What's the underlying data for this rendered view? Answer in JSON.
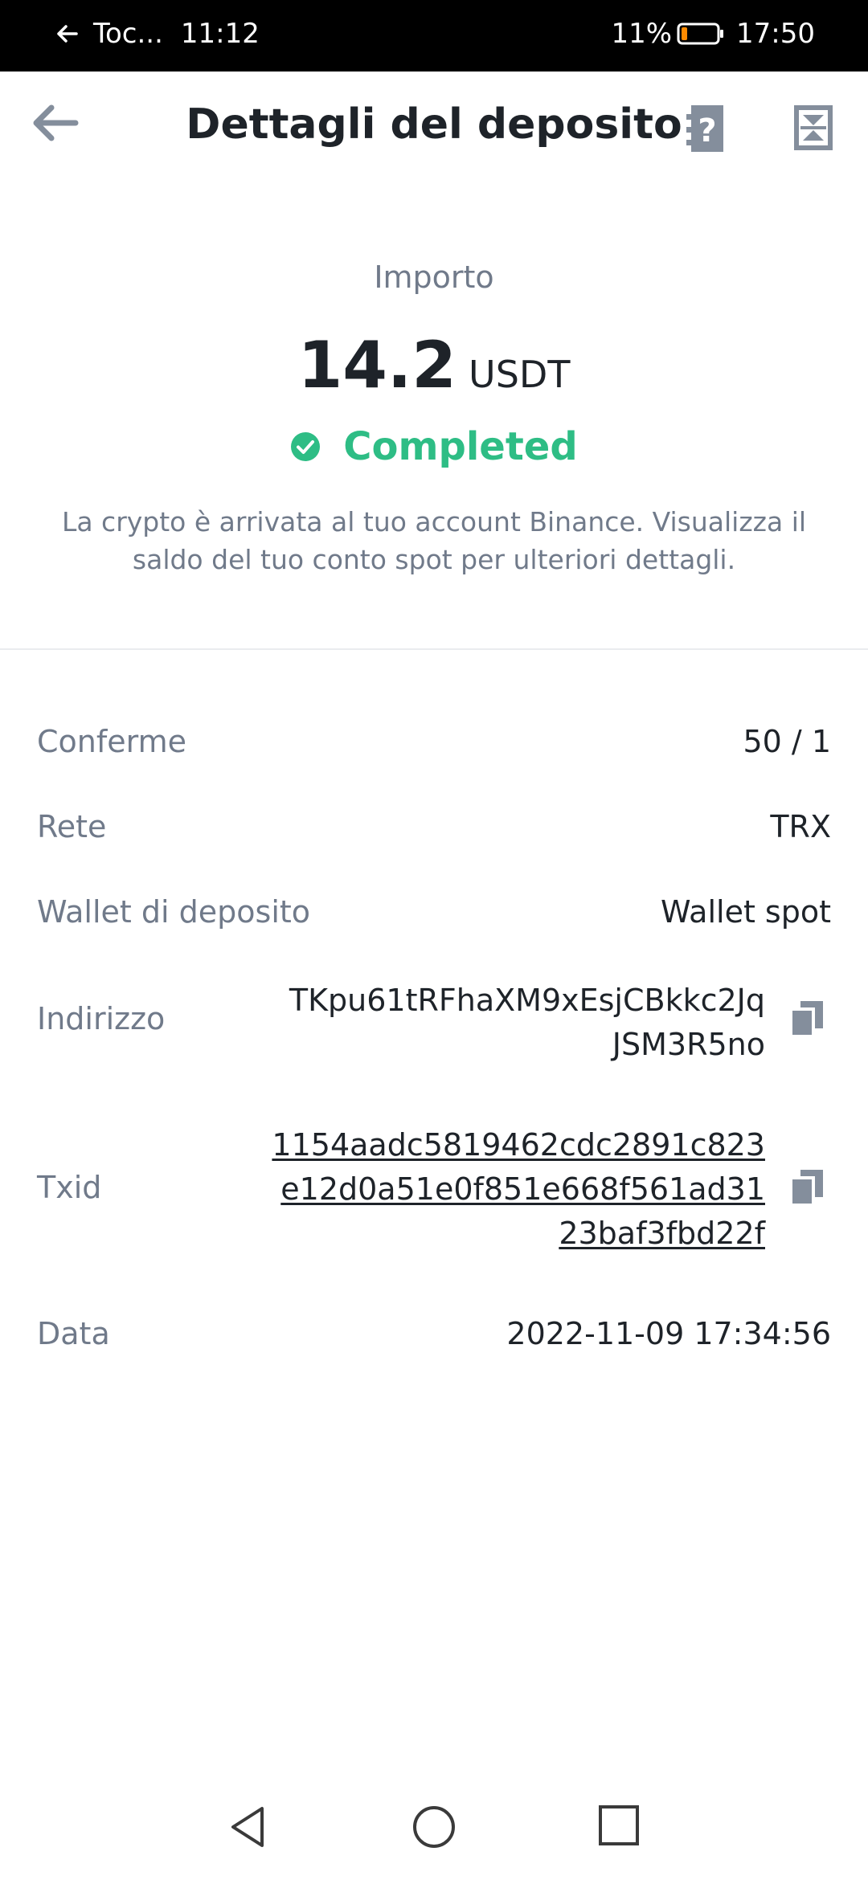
{
  "status_bar": {
    "back_text": "Toc...",
    "left_time": "11:12",
    "battery_percent": "11%",
    "time": "17:50"
  },
  "header": {
    "title": "Dettagli del deposito",
    "icons": [
      "back-arrow-icon",
      "help-icon",
      "export-icon"
    ]
  },
  "amount": {
    "label": "Importo",
    "value": "14.2",
    "currency": "USDT",
    "status": "Completed",
    "status_color": "#2ebd85",
    "info": "La crypto è arrivata al tuo account Binance. Visualizza il saldo del tuo conto spot per ulteriori dettagli."
  },
  "details": {
    "confirmations": {
      "label": "Conferme",
      "value": "50 / 1"
    },
    "network": {
      "label": "Rete",
      "value": "TRX"
    },
    "wallet": {
      "label": "Wallet di deposito",
      "value": "Wallet spot"
    },
    "address": {
      "label": "Indirizzo",
      "lines": [
        "TKpu61tRFhaXM9xEsjCBkkc2Jq",
        "JSM3R5no"
      ]
    },
    "txid": {
      "label": "Txid",
      "lines": [
        "1154aadc5819462cdc2891c823",
        "e12d0a51e0f851e668f561ad31",
        "23baf3fbd22f"
      ]
    },
    "date": {
      "label": "Data",
      "value": "2022-11-09 17:34:56"
    }
  },
  "nav_bar": {
    "icons": [
      "nav-back-icon",
      "nav-home-icon",
      "nav-recent-icon"
    ]
  }
}
